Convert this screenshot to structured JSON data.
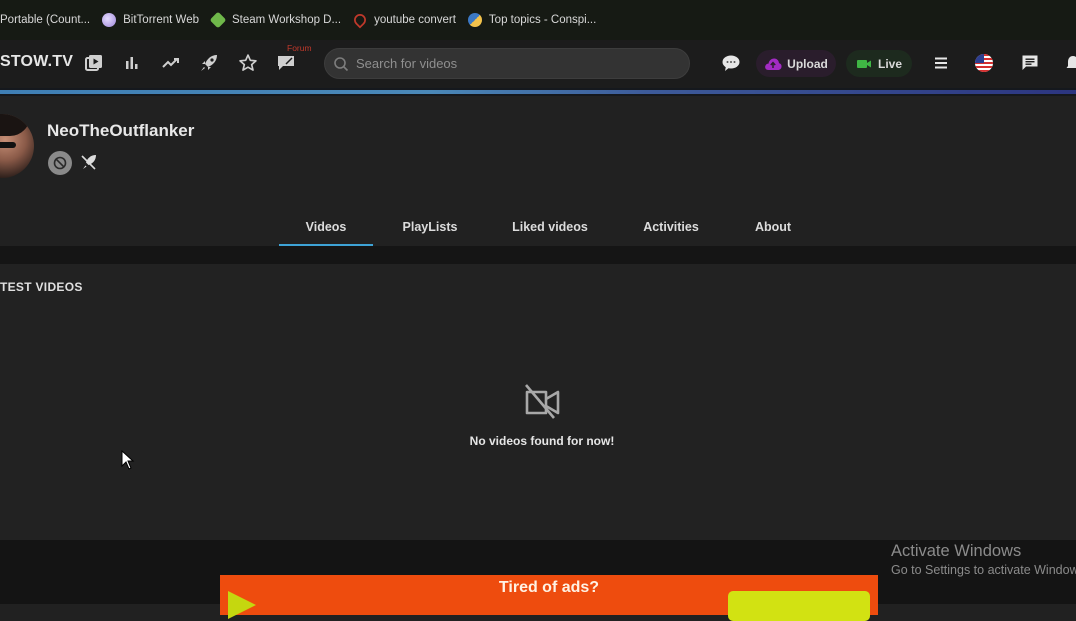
{
  "bookmarks": [
    {
      "label": "Portable (Count...",
      "icon": "page-icon",
      "color": "#161a14"
    },
    {
      "label": "BitTorrent Web",
      "icon": "bittorrent-icon",
      "color": "#b9a7e6"
    },
    {
      "label": "Steam Workshop D...",
      "icon": "steam-icon",
      "color": "#6fb84a"
    },
    {
      "label": "youtube convert",
      "icon": "pin-icon",
      "color": "#c0392b"
    },
    {
      "label": "Top topics - Conspi...",
      "icon": "discourse-icon",
      "color": "#3b78c4"
    }
  ],
  "navbar": {
    "brand": "STOW.TV",
    "icons": [
      "videos-icon",
      "stats-icon",
      "trending-icon",
      "rocket-icon",
      "star-icon",
      "forum-icon"
    ],
    "forum_label": "Forum",
    "search_placeholder": "Search for videos",
    "chat_icon": "chat-bubble-icon",
    "upload_label": "Upload",
    "live_label": "Live",
    "menu_icon": "menu-icon",
    "language": "en-US",
    "messages_icon": "messages-icon",
    "notifications_icon": "bell-icon"
  },
  "colors": {
    "accent": "#3ea3d6",
    "upload": "#a32bc4",
    "live": "#3fb544",
    "ad_bg": "#ee4c0e"
  },
  "profile": {
    "username": "NeoTheOutflanker",
    "badges": [
      "ban-icon",
      "mute-icon"
    ]
  },
  "tabs": [
    {
      "label": "Videos",
      "active": true
    },
    {
      "label": "PlayLists",
      "active": false
    },
    {
      "label": "Liked videos",
      "active": false
    },
    {
      "label": "Activities",
      "active": false
    },
    {
      "label": "About",
      "active": false
    }
  ],
  "content": {
    "section_title": "TEST VIDEOS",
    "empty_message": "No videos found for now!"
  },
  "ad": {
    "title": "Tired of ads?"
  },
  "windows_watermark": {
    "line1": "Activate Windows",
    "line2": "Go to Settings to activate Windows."
  }
}
